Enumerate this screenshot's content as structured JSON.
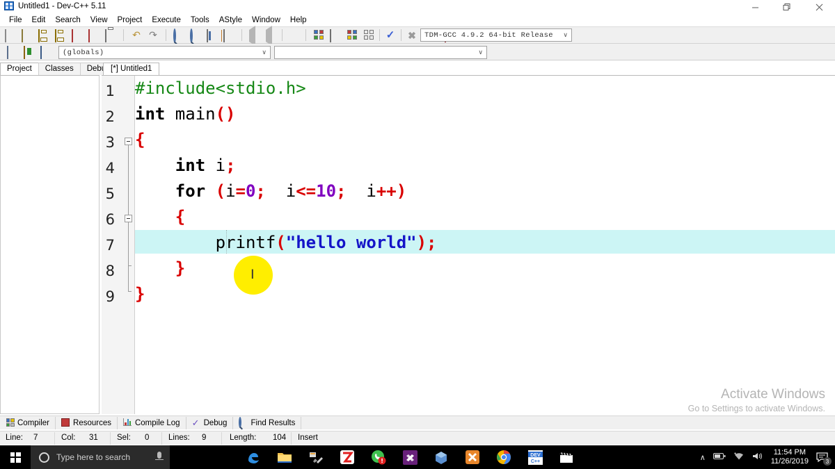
{
  "window": {
    "title": "Untitled1 - Dev-C++ 5.11",
    "minimize": "─",
    "maximize": "❐",
    "close": "✕"
  },
  "menu": [
    "File",
    "Edit",
    "Search",
    "View",
    "Project",
    "Execute",
    "Tools",
    "AStyle",
    "Window",
    "Help"
  ],
  "toolbar": {
    "compiler_combo": "TDM-GCC 4.9.2 64-bit Release",
    "scope_combo": "(globals)",
    "member_combo": "",
    "chevron": "∨",
    "icons": [
      "new-file-icon",
      "open-file-icon",
      "save-icon",
      "save-all-icon",
      "close-file-icon",
      "close-all-icon",
      "print-icon",
      "undo-icon",
      "redo-icon",
      "find-icon",
      "replace-icon",
      "goto-line-icon",
      "toggle-bookmark-icon",
      "back-icon",
      "forward-icon",
      "insert-icon",
      "new-project-icon",
      "project-options-icon",
      "compile-icon",
      "rebuild-icon",
      "compile-run-icon",
      "stop-icon",
      "profile-icon",
      "debug-icon",
      "add-to-project-icon",
      "remove-from-project-icon",
      "project-properties-icon"
    ]
  },
  "left_tabs": [
    {
      "label": "Project",
      "active": true
    },
    {
      "label": "Classes",
      "active": false
    },
    {
      "label": "Debug",
      "active": false
    }
  ],
  "editor_tabs": [
    {
      "label": "[*] Untitled1",
      "active": true
    }
  ],
  "editor": {
    "line_numbers": [
      "1",
      "2",
      "3",
      "4",
      "5",
      "6",
      "7",
      "8",
      "9"
    ],
    "highlighted_line": 7,
    "lines": [
      {
        "n": "1",
        "tokens": [
          {
            "t": "#include<stdio.h>",
            "c": "pre"
          }
        ]
      },
      {
        "n": "2",
        "tokens": [
          {
            "t": "int",
            "c": "kw"
          },
          {
            "t": " main",
            "c": ""
          },
          {
            "t": "()",
            "c": "op"
          }
        ]
      },
      {
        "n": "3",
        "tokens": [
          {
            "t": "{",
            "c": "brace"
          }
        ]
      },
      {
        "n": "4",
        "tokens": [
          {
            "t": "    ",
            "c": ""
          },
          {
            "t": "int",
            "c": "kw"
          },
          {
            "t": " i",
            "c": ""
          },
          {
            "t": ";",
            "c": "op"
          }
        ]
      },
      {
        "n": "5",
        "tokens": [
          {
            "t": "    ",
            "c": ""
          },
          {
            "t": "for",
            "c": "kw"
          },
          {
            "t": " ",
            "c": ""
          },
          {
            "t": "(",
            "c": "op"
          },
          {
            "t": "i",
            "c": ""
          },
          {
            "t": "=",
            "c": "op"
          },
          {
            "t": "0",
            "c": "num"
          },
          {
            "t": ";",
            "c": "op"
          },
          {
            "t": "  i",
            "c": ""
          },
          {
            "t": "<=",
            "c": "op"
          },
          {
            "t": "10",
            "c": "num"
          },
          {
            "t": ";",
            "c": "op"
          },
          {
            "t": "  i",
            "c": ""
          },
          {
            "t": "++)",
            "c": "op"
          }
        ]
      },
      {
        "n": "6",
        "tokens": [
          {
            "t": "    ",
            "c": ""
          },
          {
            "t": "{",
            "c": "brace"
          }
        ]
      },
      {
        "n": "7",
        "tokens": [
          {
            "t": "        printf",
            "c": ""
          },
          {
            "t": "(",
            "c": "op"
          },
          {
            "t": "\"hello world\"",
            "c": "str"
          },
          {
            "t": ");",
            "c": "op"
          }
        ]
      },
      {
        "n": "8",
        "tokens": [
          {
            "t": "    ",
            "c": ""
          },
          {
            "t": "}",
            "c": "brace"
          }
        ]
      },
      {
        "n": "9",
        "tokens": [
          {
            "t": "}",
            "c": "brace"
          }
        ]
      }
    ],
    "colors": {
      "preprocessor": "#168816",
      "keyword": "#000000",
      "operator": "#d90000",
      "number": "#8000c0",
      "string": "#1414c8",
      "active_line": "#ccf5f5",
      "cursor_highlight": "#ffee00"
    }
  },
  "watermark": {
    "line1": "Activate Windows",
    "line2": "Go to Settings to activate Windows."
  },
  "bottom_tabs": [
    {
      "label": "Compiler",
      "icon": "compiler-icon"
    },
    {
      "label": "Resources",
      "icon": "resources-icon"
    },
    {
      "label": "Compile Log",
      "icon": "compile-log-icon"
    },
    {
      "label": "Debug",
      "icon": "debug-check-icon"
    },
    {
      "label": "Find Results",
      "icon": "find-results-icon"
    }
  ],
  "status_bar": {
    "line_label": "Line:",
    "line_value": "7",
    "col_label": "Col:",
    "col_value": "31",
    "sel_label": "Sel:",
    "sel_value": "0",
    "lines_label": "Lines:",
    "lines_value": "9",
    "length_label": "Length:",
    "length_value": "104",
    "mode": "Insert"
  },
  "taskbar": {
    "start": "start-button",
    "search_placeholder": "Type here to search",
    "apps": [
      "edge-icon",
      "file-explorer-icon",
      "settings-tools-icon",
      "zoom-icon",
      "whatsapp-icon",
      "visual-studio-code-icon",
      "3d-viewer-icon",
      "xampp-icon",
      "chrome-icon",
      "dev-cpp-icon",
      "movies-tv-icon"
    ],
    "tray": {
      "chevron": "∧",
      "battery": "battery-icon",
      "wifi": "wifi-icon",
      "volume": "volume-icon",
      "time": "11:54 PM",
      "date": "11/26/2019",
      "notification_count": "3"
    }
  }
}
